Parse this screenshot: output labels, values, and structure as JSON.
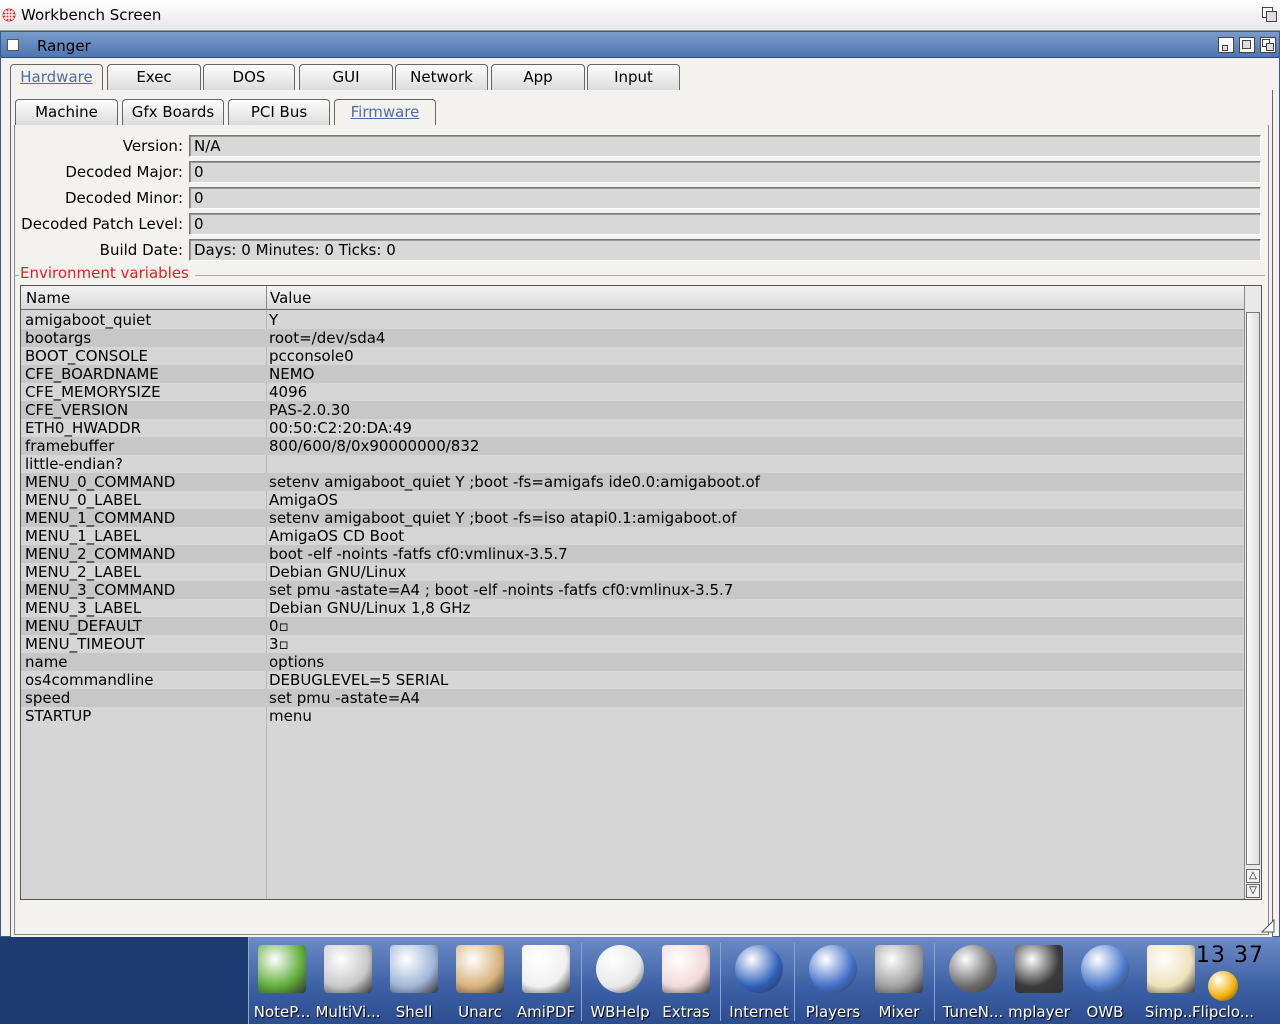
{
  "screen": {
    "title": "Workbench Screen"
  },
  "window": {
    "title": "Ranger"
  },
  "main_tabs": [
    {
      "label": "Hardware",
      "active": true
    },
    {
      "label": "Exec"
    },
    {
      "label": "DOS"
    },
    {
      "label": "GUI"
    },
    {
      "label": "Network"
    },
    {
      "label": "App"
    },
    {
      "label": "Input"
    }
  ],
  "sub_tabs": [
    {
      "label": "Machine"
    },
    {
      "label": "Gfx Boards"
    },
    {
      "label": "PCI Bus"
    },
    {
      "label": "Firmware",
      "active": true
    }
  ],
  "firmware": {
    "fields": [
      {
        "label": "Version:",
        "value": "N/A"
      },
      {
        "label": "Decoded Major:",
        "value": "0"
      },
      {
        "label": "Decoded Minor:",
        "value": "0"
      },
      {
        "label": "Decoded Patch Level:",
        "value": "0"
      },
      {
        "label": "Build Date:",
        "value": "Days: 0 Minutes: 0 Ticks: 0"
      }
    ],
    "env_title": "Environment variables",
    "columns": [
      "Name",
      "Value"
    ],
    "rows": [
      [
        "amigaboot_quiet",
        "Y"
      ],
      [
        "bootargs",
        "root=/dev/sda4"
      ],
      [
        "BOOT_CONSOLE",
        "pcconsole0"
      ],
      [
        "CFE_BOARDNAME",
        "NEMO"
      ],
      [
        "CFE_MEMORYSIZE",
        "4096"
      ],
      [
        "CFE_VERSION",
        "PAS-2.0.30"
      ],
      [
        "ETH0_HWADDR",
        "00:50:C2:20:DA:49"
      ],
      [
        "framebuffer",
        "800/600/8/0x90000000/832"
      ],
      [
        "little-endian?",
        ""
      ],
      [
        "MENU_0_COMMAND",
        "setenv amigaboot_quiet Y ;boot -fs=amigafs ide0.0:amigaboot.of"
      ],
      [
        "MENU_0_LABEL",
        "AmigaOS"
      ],
      [
        "MENU_1_COMMAND",
        "setenv amigaboot_quiet Y ;boot -fs=iso atapi0.1:amigaboot.of"
      ],
      [
        "MENU_1_LABEL",
        "AmigaOS CD Boot"
      ],
      [
        "MENU_2_COMMAND",
        "boot -elf -noints -fatfs cf0:vmlinux-3.5.7"
      ],
      [
        "MENU_2_LABEL",
        "Debian GNU/Linux"
      ],
      [
        "MENU_3_COMMAND",
        "set pmu -astate=A4 ; boot -elf -noints -fatfs cf0:vmlinux-3.5.7"
      ],
      [
        "MENU_3_LABEL",
        "Debian GNU/Linux 1,8 GHz"
      ],
      [
        "MENU_DEFAULT",
        "0▫"
      ],
      [
        "MENU_TIMEOUT",
        "3▫"
      ],
      [
        "name",
        "options"
      ],
      [
        "os4commandline",
        "DEBUGLEVEL=5 SERIAL"
      ],
      [
        "speed",
        "set pmu -astate=A4"
      ],
      [
        "STARTUP",
        "menu"
      ]
    ]
  },
  "dock": {
    "items": [
      {
        "label": "NoteP...",
        "icon": "notepad-icon",
        "color": "#5fae3a"
      },
      {
        "label": "MultiVi...",
        "icon": "magnifier-icon",
        "color": "#c8c8c8"
      },
      {
        "label": "Shell",
        "icon": "shell-icon",
        "color": "#9fb6d8"
      },
      {
        "label": "Unarc",
        "icon": "archive-icon",
        "color": "#d8b27a"
      },
      {
        "label": "AmiPDF",
        "icon": "pdf-icon",
        "color": "#f0f0f0"
      },
      {
        "label": "WBHelp",
        "icon": "lightbulb-icon",
        "color": "#e8e8e8"
      },
      {
        "label": "Extras",
        "icon": "gift-box-icon",
        "color": "#f2d8d8"
      },
      {
        "label": "Internet",
        "icon": "globe-icon",
        "color": "#2c5fb8"
      },
      {
        "label": "Players",
        "icon": "play-icon",
        "color": "#3f6ec8"
      },
      {
        "label": "Mixer",
        "icon": "mixer-slider-icon",
        "color": "#a0a0a0"
      },
      {
        "label": "TuneN...",
        "icon": "speaker-icon",
        "color": "#6a6a6a"
      },
      {
        "label": "mplayer",
        "icon": "clapper-icon",
        "color": "#3a3a3a"
      },
      {
        "label": "OWB",
        "icon": "owb-sphere-icon",
        "color": "#4a78cc"
      },
      {
        "label": "Simp...",
        "icon": "document-pencil-icon",
        "color": "#ece2b8"
      },
      {
        "label": "Flipclo...",
        "icon": "sun-icon",
        "color": "#f4b000"
      }
    ],
    "clock": "13 37"
  }
}
